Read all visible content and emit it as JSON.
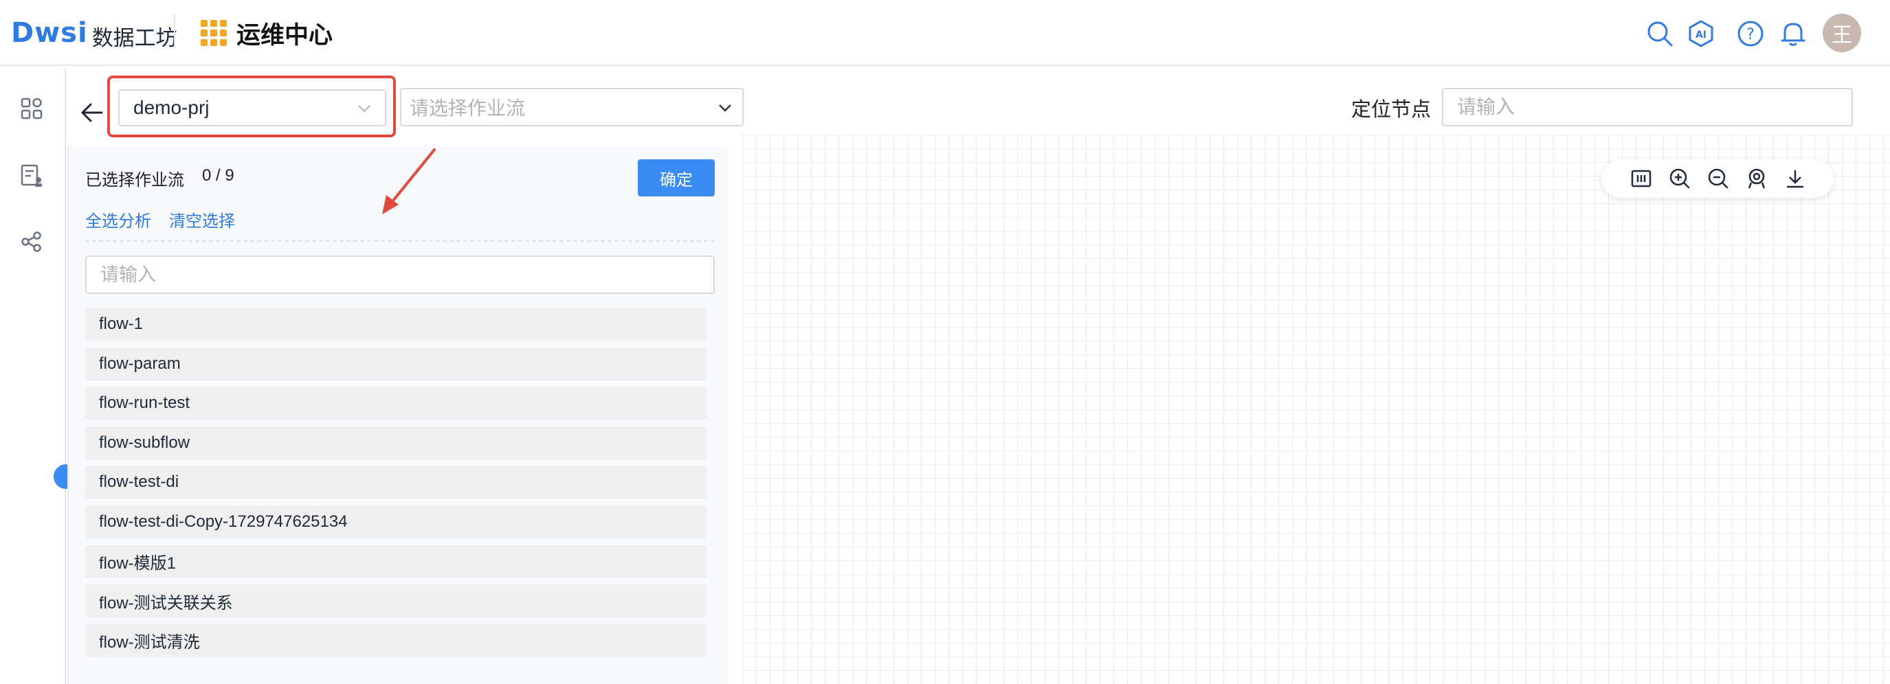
{
  "header": {
    "brand_logo": "Dwsi",
    "brand_name": "数据工坊",
    "module_title": "运维中心",
    "avatar_text": "王",
    "icons": [
      "search-icon",
      "ai-assistant-icon",
      "help-icon",
      "notification-bell-icon"
    ]
  },
  "rail": {
    "icons": [
      "apps-grid-icon",
      "document-user-icon",
      "lineage-graph-icon"
    ]
  },
  "toolbar": {
    "project_value": "demo-prj",
    "flow_placeholder": "请选择作业流",
    "locate_label": "定位节点",
    "locate_placeholder": "请输入"
  },
  "canvas_tools": [
    "fit-view-icon",
    "zoom-in-icon",
    "zoom-out-icon",
    "locate-marker-icon",
    "download-icon"
  ],
  "panel": {
    "selected_label": "已选择作业流",
    "selected_count": "0 / 9",
    "confirm_label": "确定",
    "select_all_label": "全选分析",
    "clear_label": "清空选择",
    "search_placeholder": "请输入",
    "flows": [
      "flow-1",
      "flow-param",
      "flow-run-test",
      "flow-subflow",
      "flow-test-di",
      "flow-test-di-Copy-1729747625134",
      "flow-模版1",
      "flow-测试关联关系",
      "flow-测试清洗"
    ]
  },
  "colors": {
    "accent": "#3b8cf2",
    "brand": "#2f7be0",
    "highlight": "#e24a3b",
    "module_icon": "#f5a623"
  }
}
